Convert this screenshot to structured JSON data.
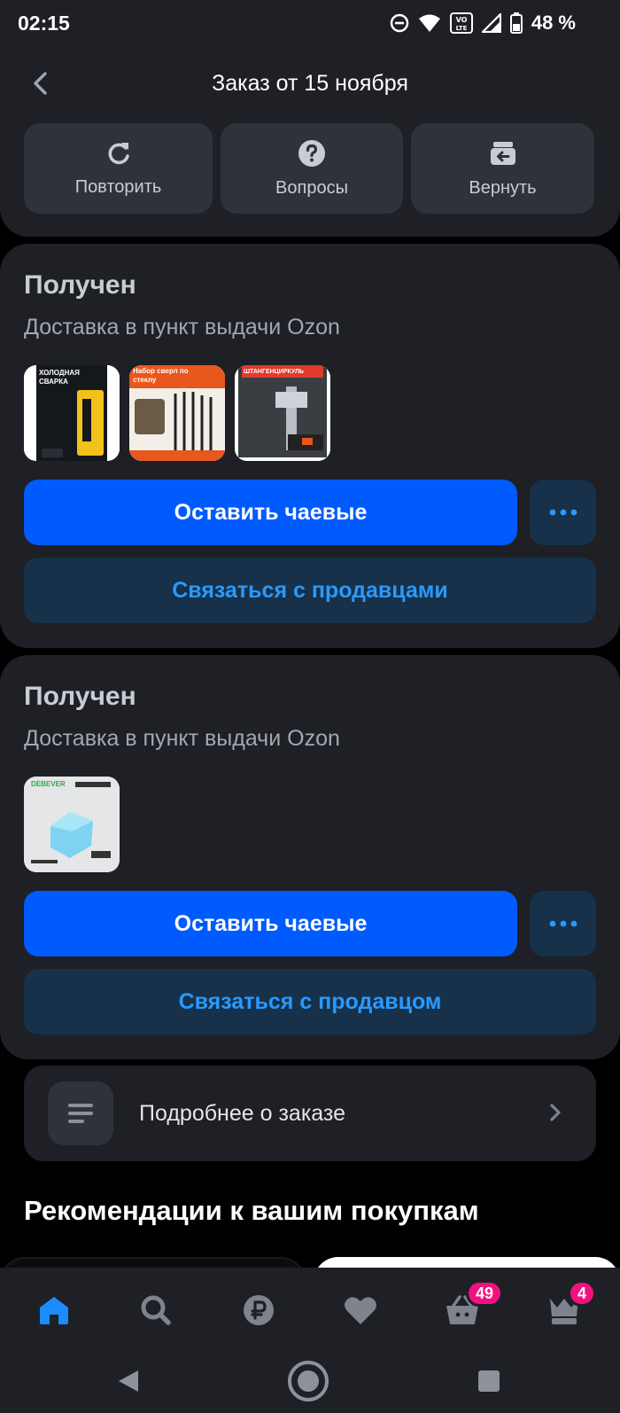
{
  "status_bar": {
    "time": "02:15",
    "battery": "48 %",
    "icons": [
      "do-not-disturb-icon",
      "wifi-icon",
      "volte-icon",
      "signal-icon",
      "battery-icon"
    ]
  },
  "header": {
    "title": "Заказ от 15 ноября",
    "actions": [
      {
        "label": "Повторить",
        "icon": "repeat-icon"
      },
      {
        "label": "Вопросы",
        "icon": "question-icon"
      },
      {
        "label": "Вернуть",
        "icon": "return-icon"
      }
    ]
  },
  "shipments": [
    {
      "status": "Получен",
      "delivery": "Доставка в пункт выдачи Ozon",
      "products": [
        {
          "caption": "ХОЛОДНАЯ СВАРКА"
        },
        {
          "caption": "Набор сверл по стеклу"
        },
        {
          "caption": "ШТАНГЕНЦИРКУЛЬ"
        }
      ],
      "tip_label": "Оставить чаевые",
      "contact_label": "Связаться с продавцами"
    },
    {
      "status": "Получен",
      "delivery": "Доставка в пункт выдачи Ozon",
      "products": [
        {
          "caption": "DEBEVER"
        }
      ],
      "tip_label": "Оставить чаевые",
      "contact_label": "Связаться с продавцом"
    }
  ],
  "details": {
    "label": "Подробнее о заказе"
  },
  "recommendations": {
    "title": "Рекомендации к вашим покупкам"
  },
  "bottom_nav": {
    "items": [
      {
        "name": "home",
        "icon": "home-icon",
        "active": true
      },
      {
        "name": "search",
        "icon": "search-icon"
      },
      {
        "name": "payments",
        "icon": "ruble-icon"
      },
      {
        "name": "favorites",
        "icon": "heart-icon"
      },
      {
        "name": "cart",
        "icon": "basket-icon",
        "badge": "49"
      },
      {
        "name": "profile",
        "icon": "crown-icon",
        "badge": "4"
      }
    ]
  },
  "colors": {
    "accent": "#005bff",
    "link": "#2a99ff",
    "surface": "#1e2026",
    "badge": "#f1117e"
  }
}
